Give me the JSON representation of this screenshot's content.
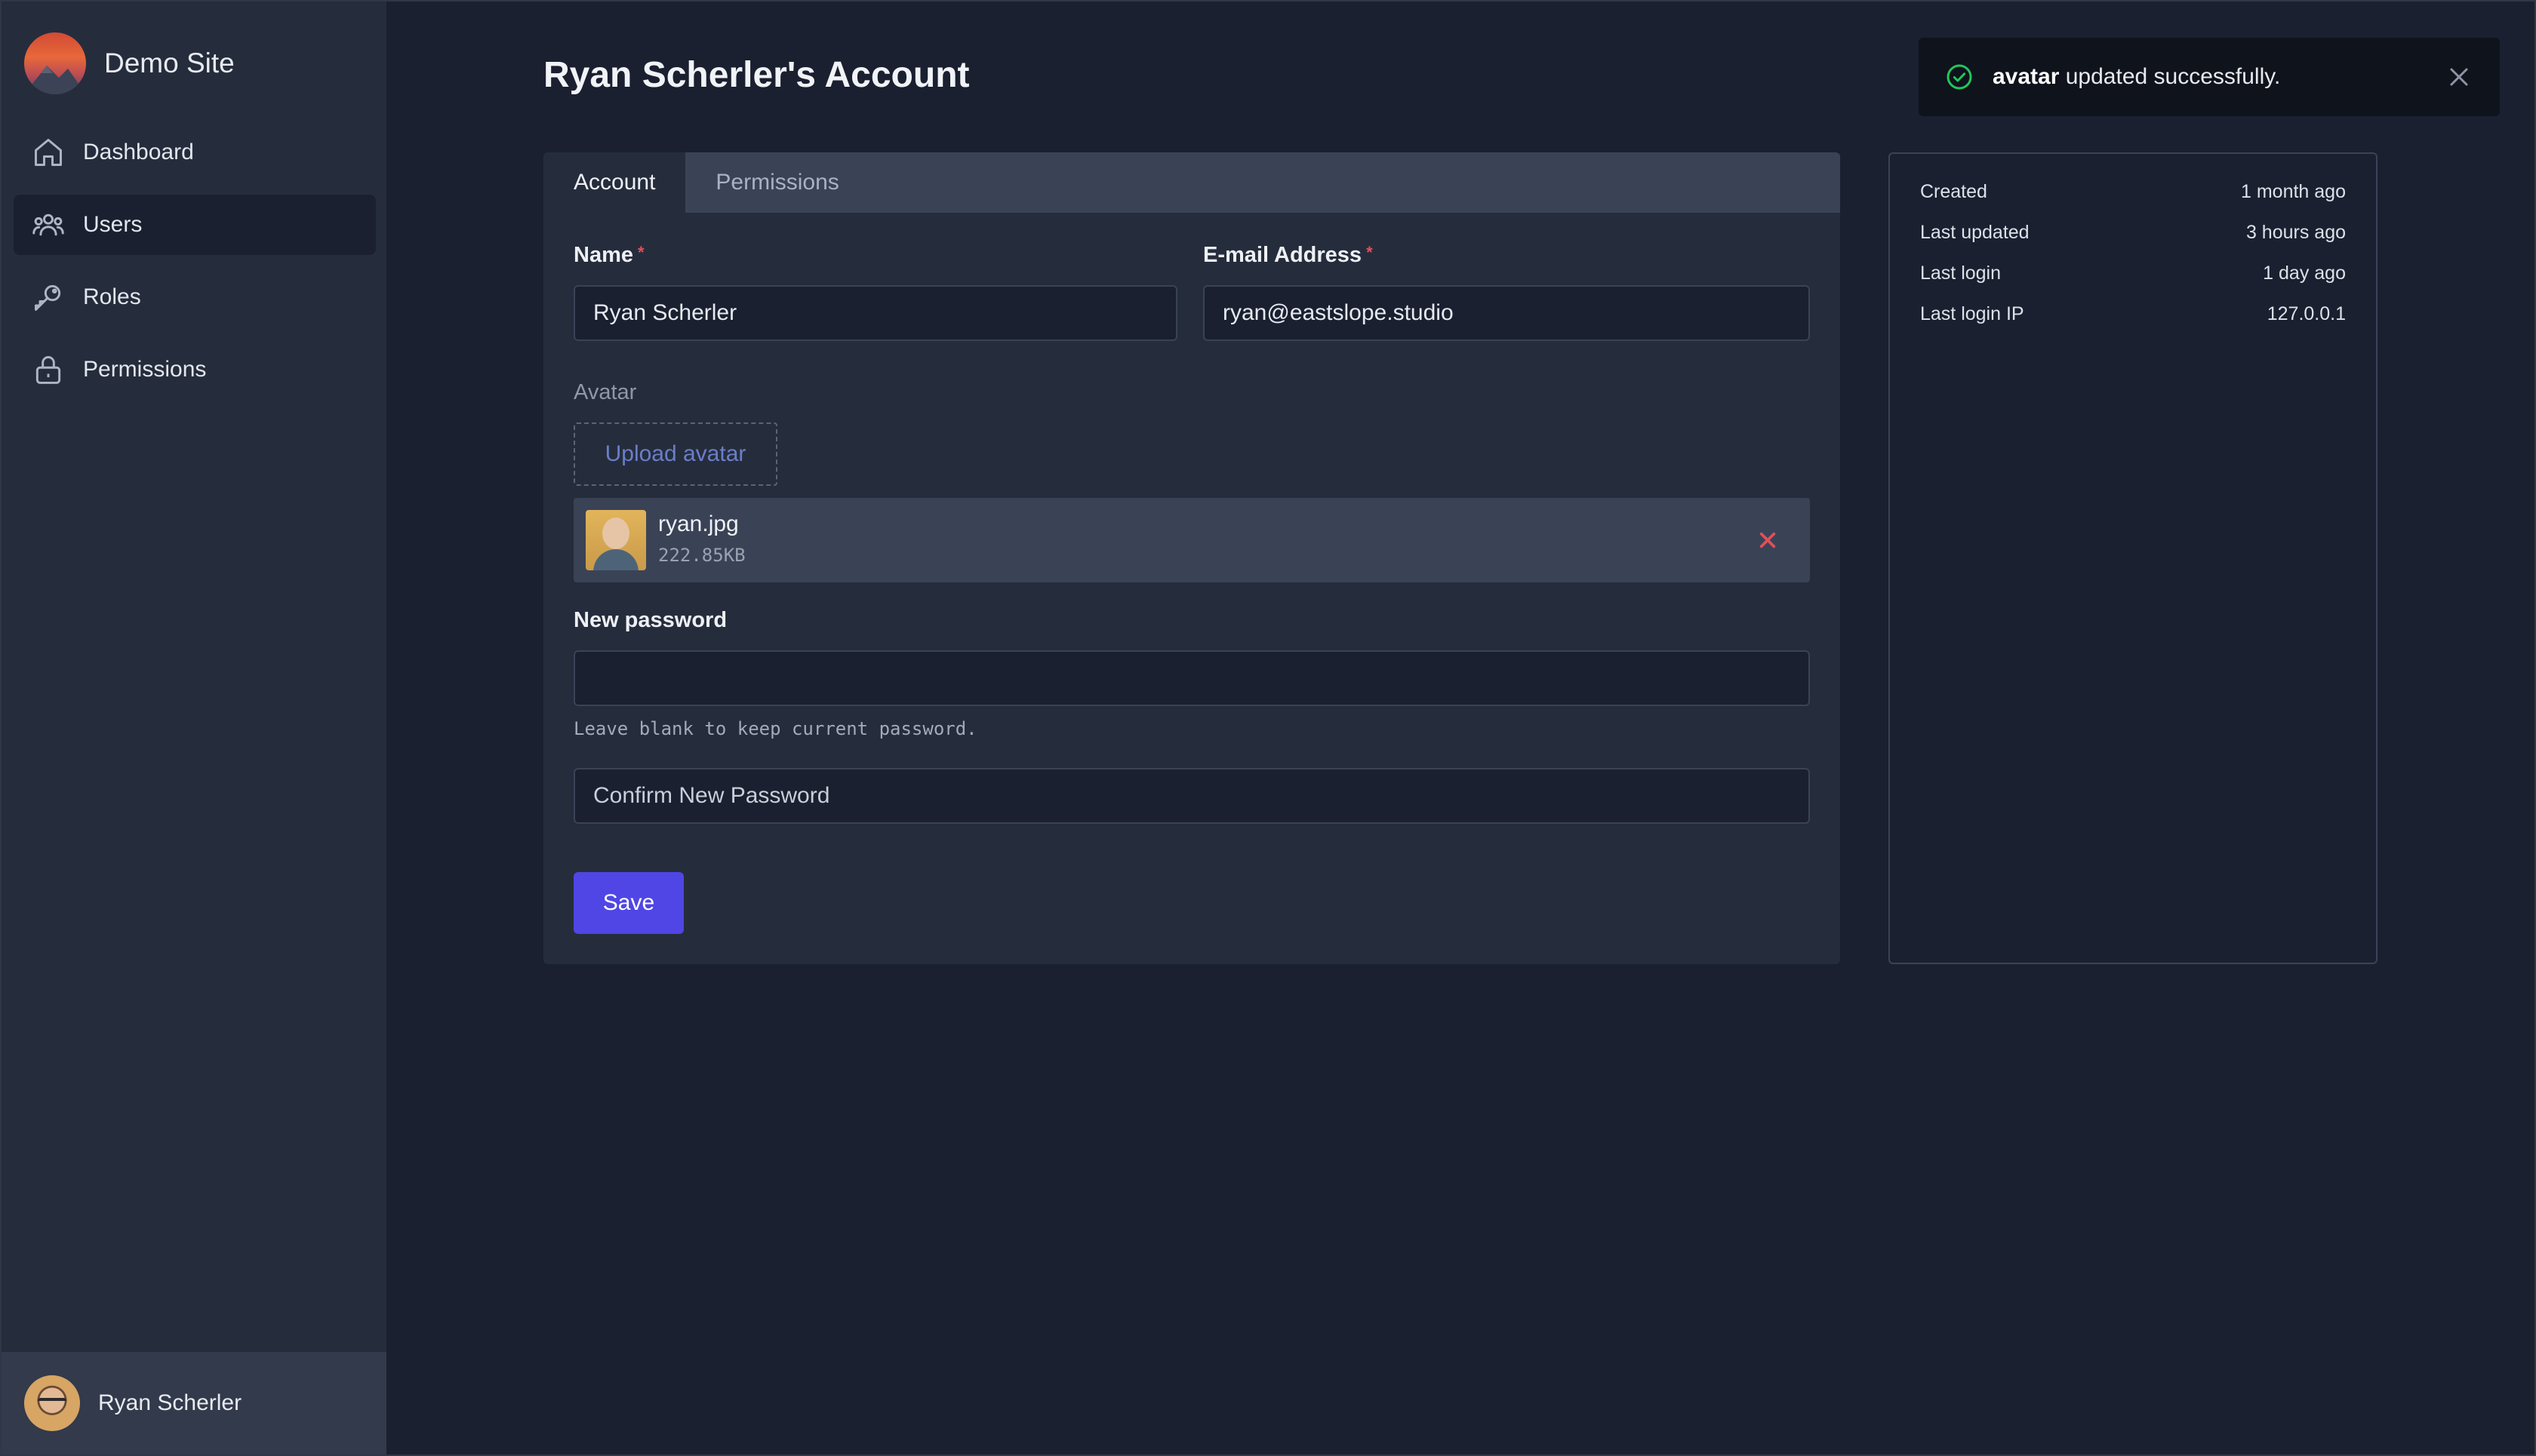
{
  "brand": {
    "name": "Demo Site"
  },
  "sidebar": {
    "items": [
      {
        "label": "Dashboard",
        "icon": "home-icon"
      },
      {
        "label": "Users",
        "icon": "users-icon",
        "active": true
      },
      {
        "label": "Roles",
        "icon": "key-icon"
      },
      {
        "label": "Permissions",
        "icon": "lock-icon"
      }
    ],
    "user": {
      "name": "Ryan Scherler"
    }
  },
  "page": {
    "title": "Ryan Scherler's Account"
  },
  "tabs": [
    {
      "label": "Account",
      "active": true
    },
    {
      "label": "Permissions",
      "active": false
    }
  ],
  "form": {
    "name_label": "Name",
    "name_value": "Ryan Scherler",
    "email_label": "E-mail Address",
    "email_value": "ryan@eastslope.studio",
    "required_marker": "*",
    "avatar_label": "Avatar",
    "upload_label": "Upload avatar",
    "file": {
      "name": "ryan.jpg",
      "size": "222.85KB"
    },
    "password_label": "New password",
    "password_value": "",
    "password_help": "Leave blank to keep current password.",
    "confirm_placeholder": "Confirm New Password",
    "save_label": "Save"
  },
  "meta": [
    {
      "label": "Created",
      "value": "1 month ago"
    },
    {
      "label": "Last updated",
      "value": "3 hours ago"
    },
    {
      "label": "Last login",
      "value": "1 day ago"
    },
    {
      "label": "Last login IP",
      "value": "127.0.0.1"
    }
  ],
  "toast": {
    "field": "avatar",
    "message": " updated successfully.",
    "icon": "check-circle-icon",
    "color": "#22c55e"
  },
  "colors": {
    "accent": "#4f46e5",
    "danger": "#e0505a",
    "success": "#22c55e"
  }
}
